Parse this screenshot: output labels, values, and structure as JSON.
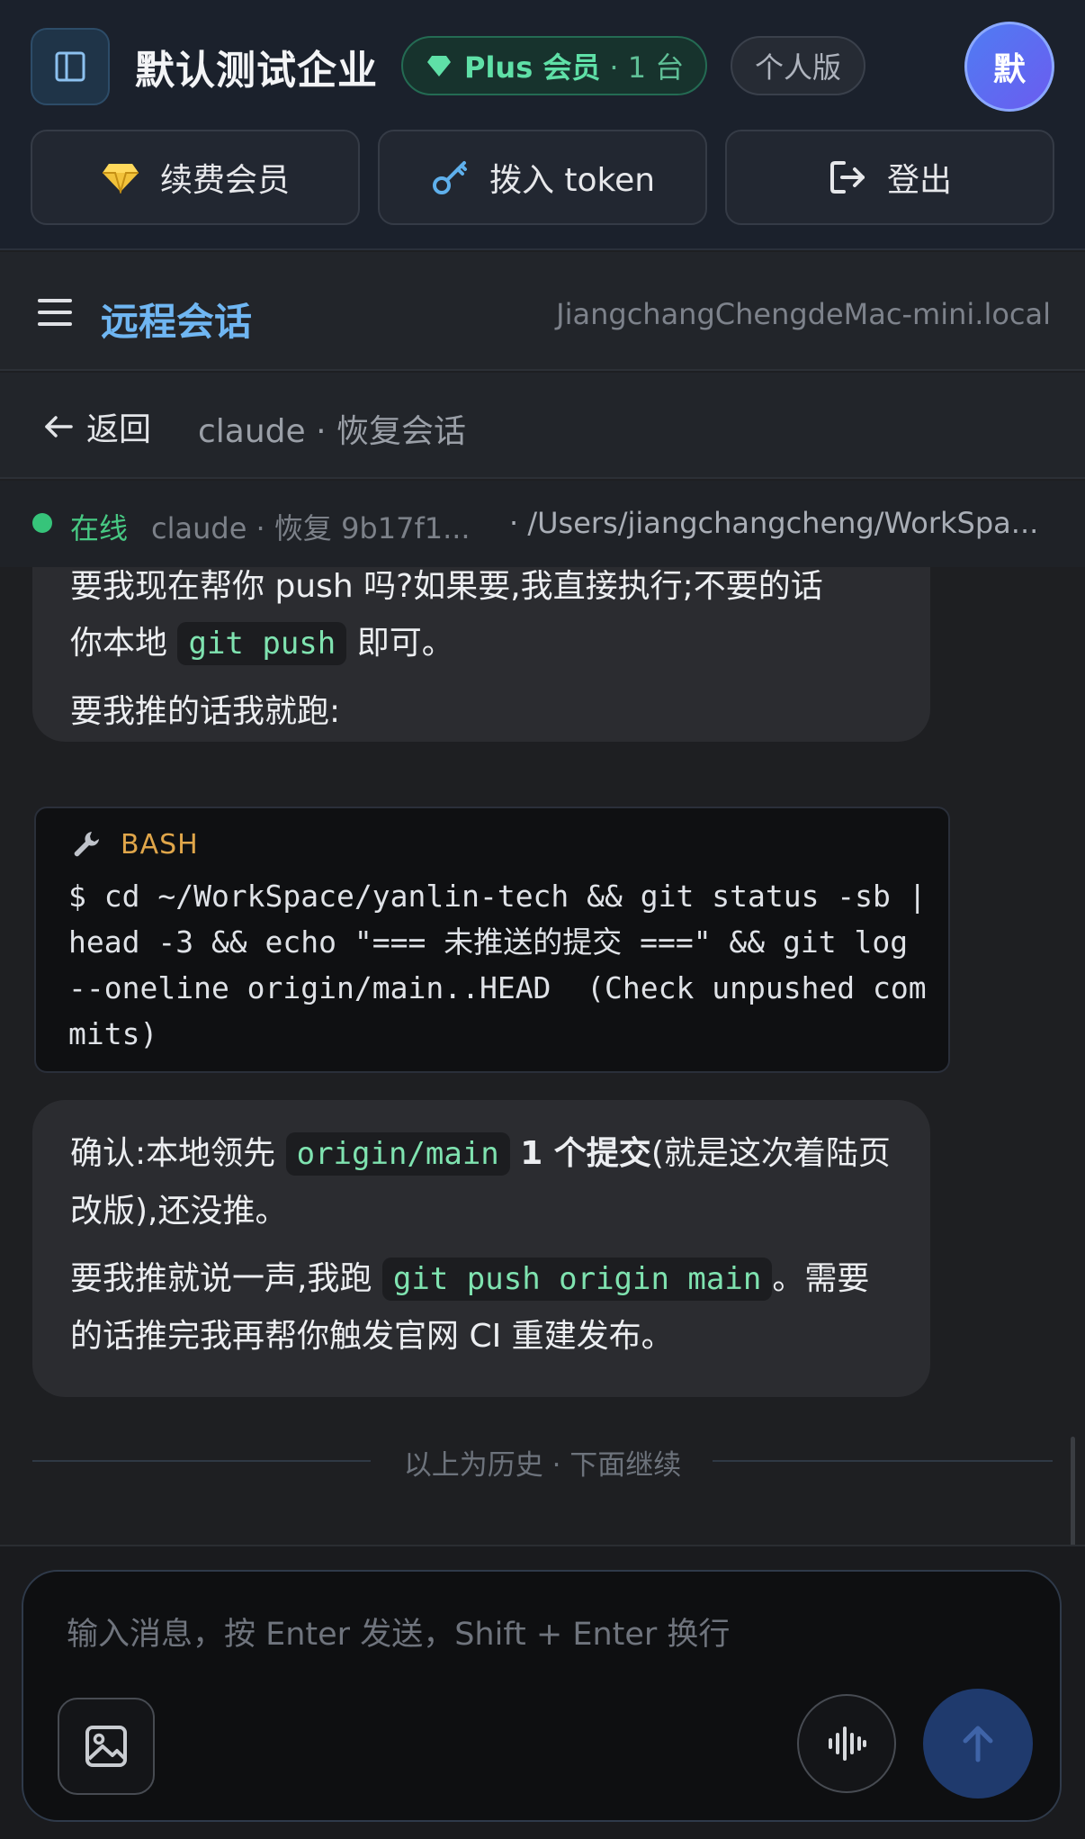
{
  "header": {
    "org_title": "默认测试企业",
    "plan_name": "Plus 会员",
    "plan_devices": "· 1 台",
    "edition": "个人版",
    "avatar_initial": "默",
    "actions": {
      "renew": "续费会员",
      "token": "拨入 token",
      "logout": "登出"
    }
  },
  "nav": {
    "title": "远程会话",
    "host": "JiangchangChengdeMac-mini.local"
  },
  "breadcrumb": {
    "back_label": "返回",
    "session_title": "claude · 恢复会话"
  },
  "status": {
    "online": "在线",
    "session": "claude · 恢复 9b17f1...",
    "path": "· /Users/jiangchangcheng/WorkSpa..."
  },
  "messages": {
    "m1": {
      "line1": "要我现在帮你 push 吗?如果要,我直接执行;不要的话",
      "line2_prefix": "你本地",
      "code": "git push",
      "line2_suffix": "即可。",
      "line3": "要我推的话我就跑:"
    },
    "bash": {
      "label": "BASH",
      "command": "$ cd ~/WorkSpace/yanlin-tech && git status -sb | head -3 && echo \"=== 未推送的提交 ===\" && git log --oneline origin/main..HEAD  (Check unpushed commits)"
    },
    "m2": {
      "prefix": "确认:本地领先",
      "code1": "origin/main",
      "bold": "1 个提交",
      "suffix": "(就是这次着陆页改版),还没推。",
      "p2_prefix": "要我推就说一声,我跑",
      "code2": "git push origin main",
      "p2_suffix": "。需要的话推完我再帮你触发官网 CI 重建发布。"
    }
  },
  "divider": "以上为历史 · 下面继续",
  "composer": {
    "placeholder": "输入消息，按 Enter 发送，Shift + Enter 换行"
  },
  "colors": {
    "accent_blue": "#6fb6f2",
    "online_green": "#36c47a",
    "plan_green": "#5fe0a7",
    "bash_label": "#e0a64a",
    "inline_code": "#7fe3b0"
  },
  "icons": {
    "sidebar": "sidebar-toggle-icon",
    "plan": "diamond-icon",
    "renew": "diamond-icon",
    "token": "key-icon",
    "logout": "logout-icon",
    "menu": "hamburger-menu-icon",
    "back": "arrow-left-icon",
    "bash": "wrench-icon",
    "image": "image-icon",
    "voice": "waveform-icon",
    "send": "arrow-up-icon"
  }
}
